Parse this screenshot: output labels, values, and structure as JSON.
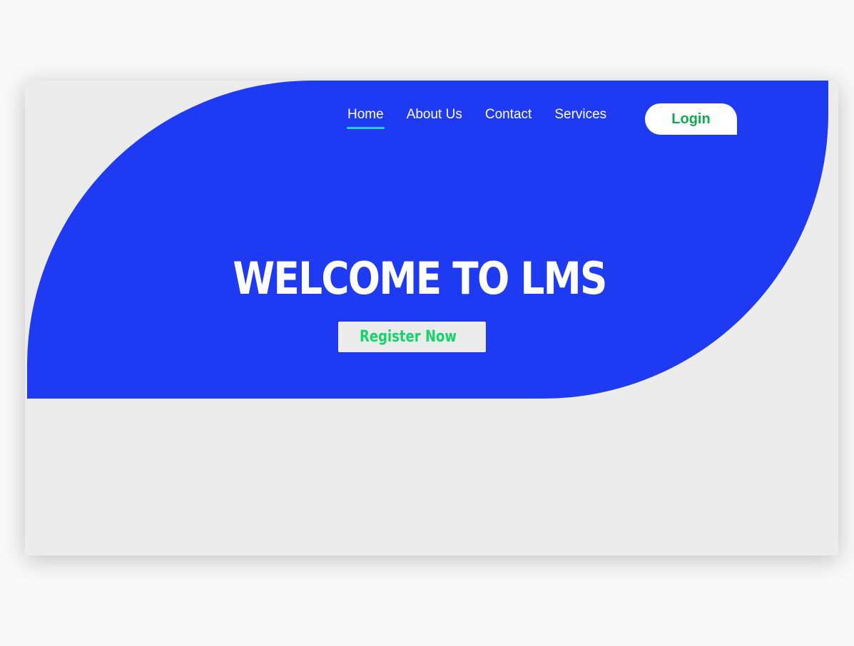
{
  "nav": {
    "items": [
      {
        "label": "Home",
        "active": true
      },
      {
        "label": "About Us",
        "active": false
      },
      {
        "label": "Contact",
        "active": false
      },
      {
        "label": "Services",
        "active": false
      }
    ],
    "login_label": "Login"
  },
  "hero": {
    "title": "WELCOME TO LMS",
    "register_label": "Register Now"
  },
  "colors": {
    "page_background": "#f9f9f9",
    "card_background": "#ececec",
    "hero_blue": "#1e3af2",
    "active_underline": "#21d4c4",
    "login_text": "#12a94a",
    "register_text": "#14d46c"
  }
}
